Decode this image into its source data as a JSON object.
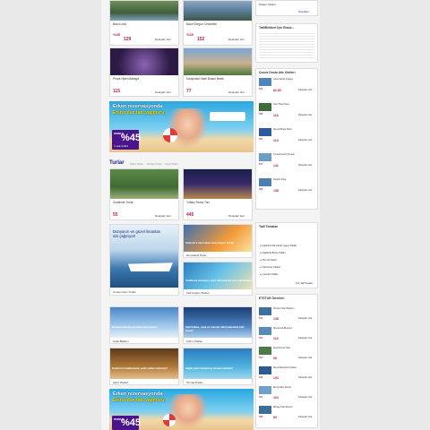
{
  "colors": {
    "accent": "#c2185b",
    "navy": "#1a237e",
    "purple": "#6a1b9a",
    "orange": "#ff7a00"
  },
  "top_hotels": [
    {
      "name": "Barut Lara",
      "pct": "%35",
      "price": "129",
      "detail": "Detayları Gör"
    },
    {
      "name": "Barut Sorgun Cennetleri",
      "pct": "%30",
      "price": "152",
      "detail": "Detayları Gör"
    },
    {
      "name": "Pırıza Hotel Mabiyya",
      "pct": "",
      "price": "115",
      "detail": "Detayları Gör"
    },
    {
      "name": "Kampinski Hotel Bosbo Belek",
      "pct": "",
      "price": "77",
      "detail": "Detayları Gör"
    }
  ],
  "banner": {
    "line1": "Erken rezervasyonda",
    "line2": "Etstur'dan tatil yağmuru!",
    "world": "WORLD",
    "pct": "%45",
    "note": "'e varan indirim"
  },
  "tours": {
    "title": "Turlar",
    "tabs": [
      "Kültür Turları",
      "Yurtdışı Turları",
      "Gemi Turları"
    ],
    "items": [
      {
        "name": "Cezalırde Turlar",
        "price": "55",
        "detail": "Detayları Gör"
      },
      {
        "name": "Yılbaşı Roma Turu",
        "price": "445",
        "detail": "Detayları Gör"
      }
    ]
  },
  "cruise": {
    "title": "Dünyanın en güzel limanları sizi çağırıyor!",
    "link": "Cruise Gemi Turları"
  },
  "promo_cards": [
    {
      "caption": "Sömestr'e özel erken rezervasyon fırsatı!",
      "link": "Dünyaland Paris"
    },
    {
      "caption": "Uzaklarda aramayın, sizin tatil adresini çok yakınınızda!",
      "link": "Tatil Köyleri Otelleri"
    },
    {
      "caption": "Kampanyalardan fırsatları kaçırmayın!",
      "link": "Uçak Biletleri"
    },
    {
      "caption": "Tatil haftası, uçak ve transfer dahil paketlerle tatil fırsatı!",
      "link": "Kıbrıs Otelleri"
    },
    {
      "caption": "Konforlu konaklamanın şehir otelleri adresleri!",
      "link": "Şehir Otelleri"
    },
    {
      "caption": "Sağlık geliri tazelenme müsaat şehirleri!",
      "link": "Termal Oteller"
    }
  ],
  "side": {
    "top_label": "Otelleri Otelleri",
    "top_label2": "Öneriliyor",
    "tatil_box_title": "TatilRehberi İçin Etstur...",
    "family_title": "Çocuk Dostu Aile Otelleri",
    "family_items": [
      {
        "name": "Lykia World Antalya",
        "pct": "%4",
        "price": "62.65"
      },
      {
        "name": "Club Hotel Sera",
        "pct": "%8",
        "price": "116"
      },
      {
        "name": "Royal Wings Hotel",
        "pct": "%5",
        "price": "119"
      },
      {
        "name": "Crystal Family Resort",
        "pct": "%7",
        "price": "141"
      },
      {
        "name": "Delphin Diva",
        "pct": "%8",
        "price": "138"
      }
    ],
    "themes_title": "Tatil Temaları",
    "themes": [
      "Sahibinli Manzaralı Uygun Tatiller",
      "Plajlarda Bütçe Tatiller",
      "Termal Oteller",
      "Tatil Köyü Otelleri",
      "Çocuklu Tatiller"
    ],
    "themes_more": "Tüm Tatil Temaları",
    "offers_title": "ETSTUR Önerileri",
    "offers": [
      {
        "name": "Kirman Hotel Belazur",
        "pct": "%4",
        "price": "138"
      },
      {
        "name": "Sherwood Breezes",
        "pct": "%4",
        "price": "110"
      },
      {
        "name": "Alva Donna Hotel",
        "pct": "%1",
        "price": "98"
      },
      {
        "name": "Royal Alhambra Palace",
        "pct": "%8",
        "price": "153"
      },
      {
        "name": "Ela Quality Resort",
        "pct": "%5",
        "price": "164"
      },
      {
        "name": "Mirage Park Resort",
        "pct": "%8",
        "price": "89"
      }
    ],
    "detail": "Detayları Gör"
  }
}
